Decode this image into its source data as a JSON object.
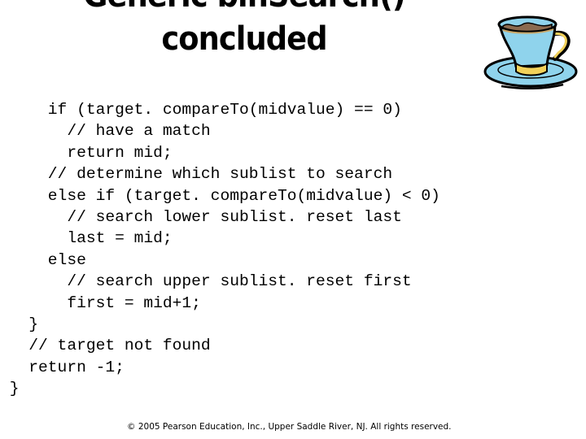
{
  "slide": {
    "title_line1": "Generic binSearch()",
    "title_line2": "concluded",
    "icon": "coffee-cup-icon",
    "colors": {
      "cup_body": "#8fd3ec",
      "cup_trim": "#f2d15a",
      "coffee": "#8b6a4f",
      "outline": "#000000"
    },
    "code_lines": [
      {
        "indent": "     ",
        "text": "if (target. compareTo(midvalue) == 0)"
      },
      {
        "indent": "       ",
        "text": "// have a match"
      },
      {
        "indent": "       ",
        "text": "return mid;"
      },
      {
        "indent": "     ",
        "text": "// determine which sublist to search"
      },
      {
        "indent": "     ",
        "text": "else if (target. compareTo(midvalue) < 0)"
      },
      {
        "indent": "       ",
        "text": "// search lower sublist. reset last"
      },
      {
        "indent": "       ",
        "text": "last = mid;"
      },
      {
        "indent": "     ",
        "text": "else"
      },
      {
        "indent": "       ",
        "text": "// search upper sublist. reset first"
      },
      {
        "indent": "       ",
        "text": "first = mid+1;"
      },
      {
        "indent": "   ",
        "text": "}"
      },
      {
        "indent": "   ",
        "text": "// target not found"
      },
      {
        "indent": "   ",
        "text": "return -1;"
      },
      {
        "indent": " ",
        "text": "}"
      }
    ],
    "footer": "© 2005 Pearson Education, Inc., Upper Saddle River, NJ.  All rights reserved."
  }
}
